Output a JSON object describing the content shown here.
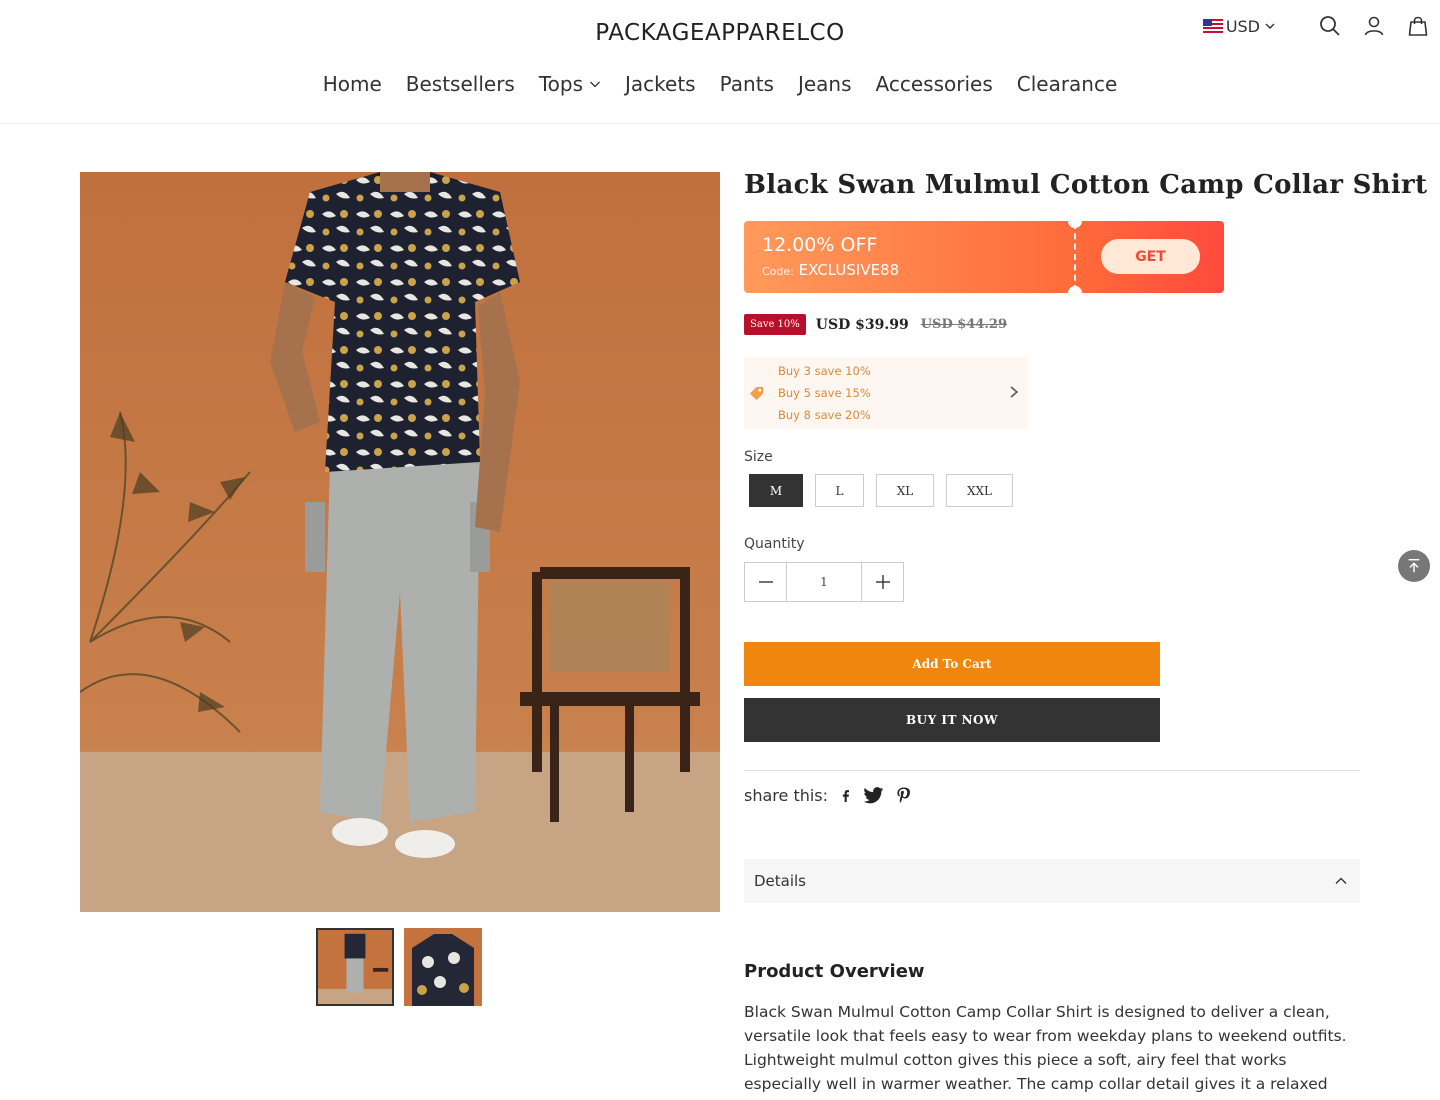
{
  "header": {
    "logo": "PACKAGEAPPARELCO",
    "currency": "USD",
    "icons": [
      "us-flag-icon",
      "chevron-down-icon",
      "search-icon",
      "account-icon",
      "cart-icon"
    ]
  },
  "nav": {
    "items": [
      {
        "label": "Home"
      },
      {
        "label": "Bestsellers"
      },
      {
        "label": "Tops"
      },
      {
        "label": "Jackets"
      },
      {
        "label": "Pants"
      },
      {
        "label": "Jeans"
      },
      {
        "label": "Accessories"
      },
      {
        "label": "Clearance"
      }
    ]
  },
  "product": {
    "title": "Black Swan Mulmul Cotton Camp Collar Shirt",
    "coupon": {
      "discount": "12.00% OFF",
      "code_label": "Code:",
      "code": "EXCLUSIVE88",
      "get_label": "GET"
    },
    "price": {
      "save_badge": "Save 10%",
      "current": "USD $39.99",
      "original": "USD $44.29"
    },
    "bundle": {
      "lines": [
        "Buy 3 save 10%",
        "Buy 5 save 15%",
        "Buy 8 save 20%"
      ]
    },
    "size": {
      "label": "Size",
      "options": [
        "M",
        "L",
        "XL",
        "XXL"
      ],
      "selected": "M"
    },
    "quantity": {
      "label": "Quantity",
      "value": "1"
    },
    "add_to_cart": "Add To Cart",
    "buy_now": "BUY IT NOW",
    "share": {
      "label": "share this:",
      "icons": [
        "facebook-icon",
        "twitter-icon",
        "pinterest-icon"
      ]
    },
    "details": {
      "label": "Details"
    },
    "overview": {
      "heading": "Product Overview",
      "text": "Black Swan Mulmul Cotton Camp Collar Shirt is designed to deliver a clean, versatile look that feels easy to wear from weekday plans to weekend outfits. Lightweight mulmul cotton gives this piece a soft, airy feel that works especially well in warmer weather. The camp collar detail gives it a relaxed"
    }
  },
  "colors": {
    "add_to_cart": "#f0860e",
    "buy_now": "#333333",
    "save_badge": "#b8102a",
    "coupon_start": "#ff9a5b",
    "coupon_end": "#ff4a3c",
    "bundle_text": "#d88a3c"
  }
}
